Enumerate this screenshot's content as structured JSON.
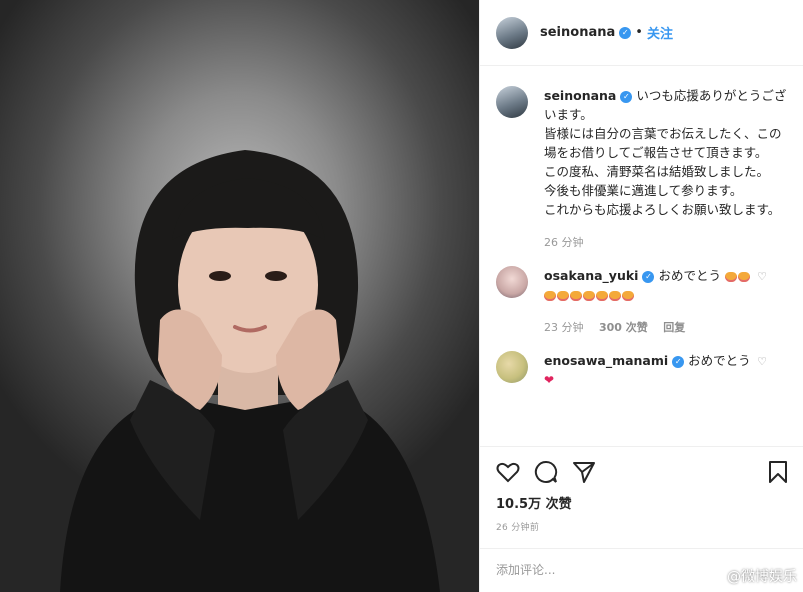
{
  "header": {
    "username": "seinonana",
    "separator": "•",
    "follow": "关注"
  },
  "caption": {
    "username": "seinonana",
    "lines": [
      "いつも応援ありがとうございます。",
      "皆様には自分の言葉でお伝えしたく、この場をお借りしてご報告させて頂きます。",
      "この度私、清野菜名は結婚致しました。",
      "今後も俳優業に邁進して参ります。",
      "これからも応援よろしくお願い致します。"
    ],
    "time": "26 分钟"
  },
  "comments": [
    {
      "username": "osakana_yuki",
      "text": "おめでとう",
      "time": "23 分钟",
      "likes": "300 次赞",
      "reply": "回复"
    },
    {
      "username": "enosawa_manami",
      "text": "おめでとう"
    }
  ],
  "post": {
    "likes": "10.5万 次赞",
    "time": "26 分钟前"
  },
  "add_comment": {
    "placeholder": "添加评论..."
  },
  "watermark": "@微博娱乐",
  "colors": {
    "verified": "#3897f0",
    "follow": "#3897f0",
    "heart": "#e0245e"
  }
}
